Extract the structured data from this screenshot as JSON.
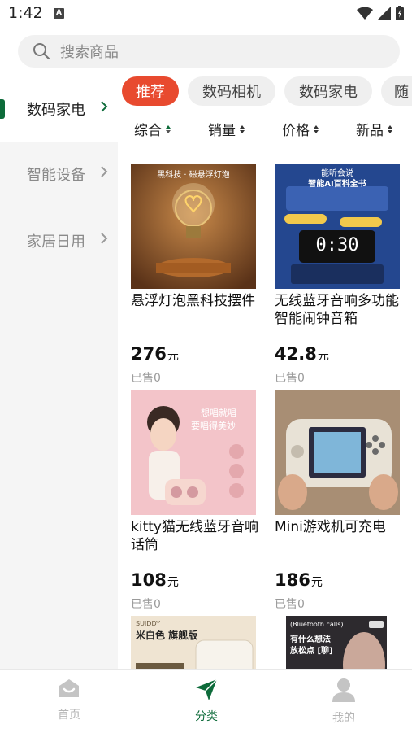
{
  "status_bar": {
    "time": "1:42",
    "badge": "A"
  },
  "search": {
    "placeholder": "搜索商品"
  },
  "sidebar": {
    "items": [
      {
        "label": "数码家电",
        "active": true
      },
      {
        "label": "智能设备",
        "active": false
      },
      {
        "label": "家居日用",
        "active": false
      }
    ]
  },
  "chips": [
    {
      "label": "推荐",
      "active": true
    },
    {
      "label": "数码相机",
      "active": false
    },
    {
      "label": "数码家电",
      "active": false
    },
    {
      "label": "随",
      "active": false
    }
  ],
  "sort": [
    {
      "label": "综合",
      "active": true
    },
    {
      "label": "销量",
      "active": false
    },
    {
      "label": "价格",
      "active": false
    },
    {
      "label": "新品",
      "active": false
    }
  ],
  "products": [
    {
      "name": "悬浮灯泡黑科技摆件",
      "price": "276",
      "unit": "元",
      "sold": "已售0",
      "image_caption": "黑科技 · 磁悬浮灯泡"
    },
    {
      "name": "无线蓝牙音响多功能智能闹钟音箱",
      "price": "42.8",
      "unit": "元",
      "sold": "已售0",
      "image_caption": "能听会说",
      "image_caption_2": "智能AI百科全书",
      "clock": "0:30"
    },
    {
      "name": "kitty猫无线蓝牙音响话筒",
      "price": "108",
      "unit": "元",
      "sold": "已售0",
      "image_caption": "想唱就唱",
      "image_caption_2": "要唱得美妙"
    },
    {
      "name": "Mini游戏机可充电",
      "price": "186",
      "unit": "元",
      "sold": "已售0"
    },
    {
      "name": "",
      "image_caption": "SUIDDY",
      "image_caption_2": "米白色 旗舰版"
    },
    {
      "name": "",
      "image_caption": "(Bluetooth calls)",
      "image_caption_2": "有什么想法",
      "image_caption_3": "放松点 [聊]"
    }
  ],
  "bottom_nav": [
    {
      "label": "首页",
      "icon": "home-icon",
      "active": false
    },
    {
      "label": "分类",
      "icon": "send-icon",
      "active": true
    },
    {
      "label": "我的",
      "icon": "user-icon",
      "active": false
    }
  ],
  "colors": {
    "accent": "#0d6b3a",
    "chip_active": "#e84a2f",
    "muted": "#8a8a8a"
  }
}
